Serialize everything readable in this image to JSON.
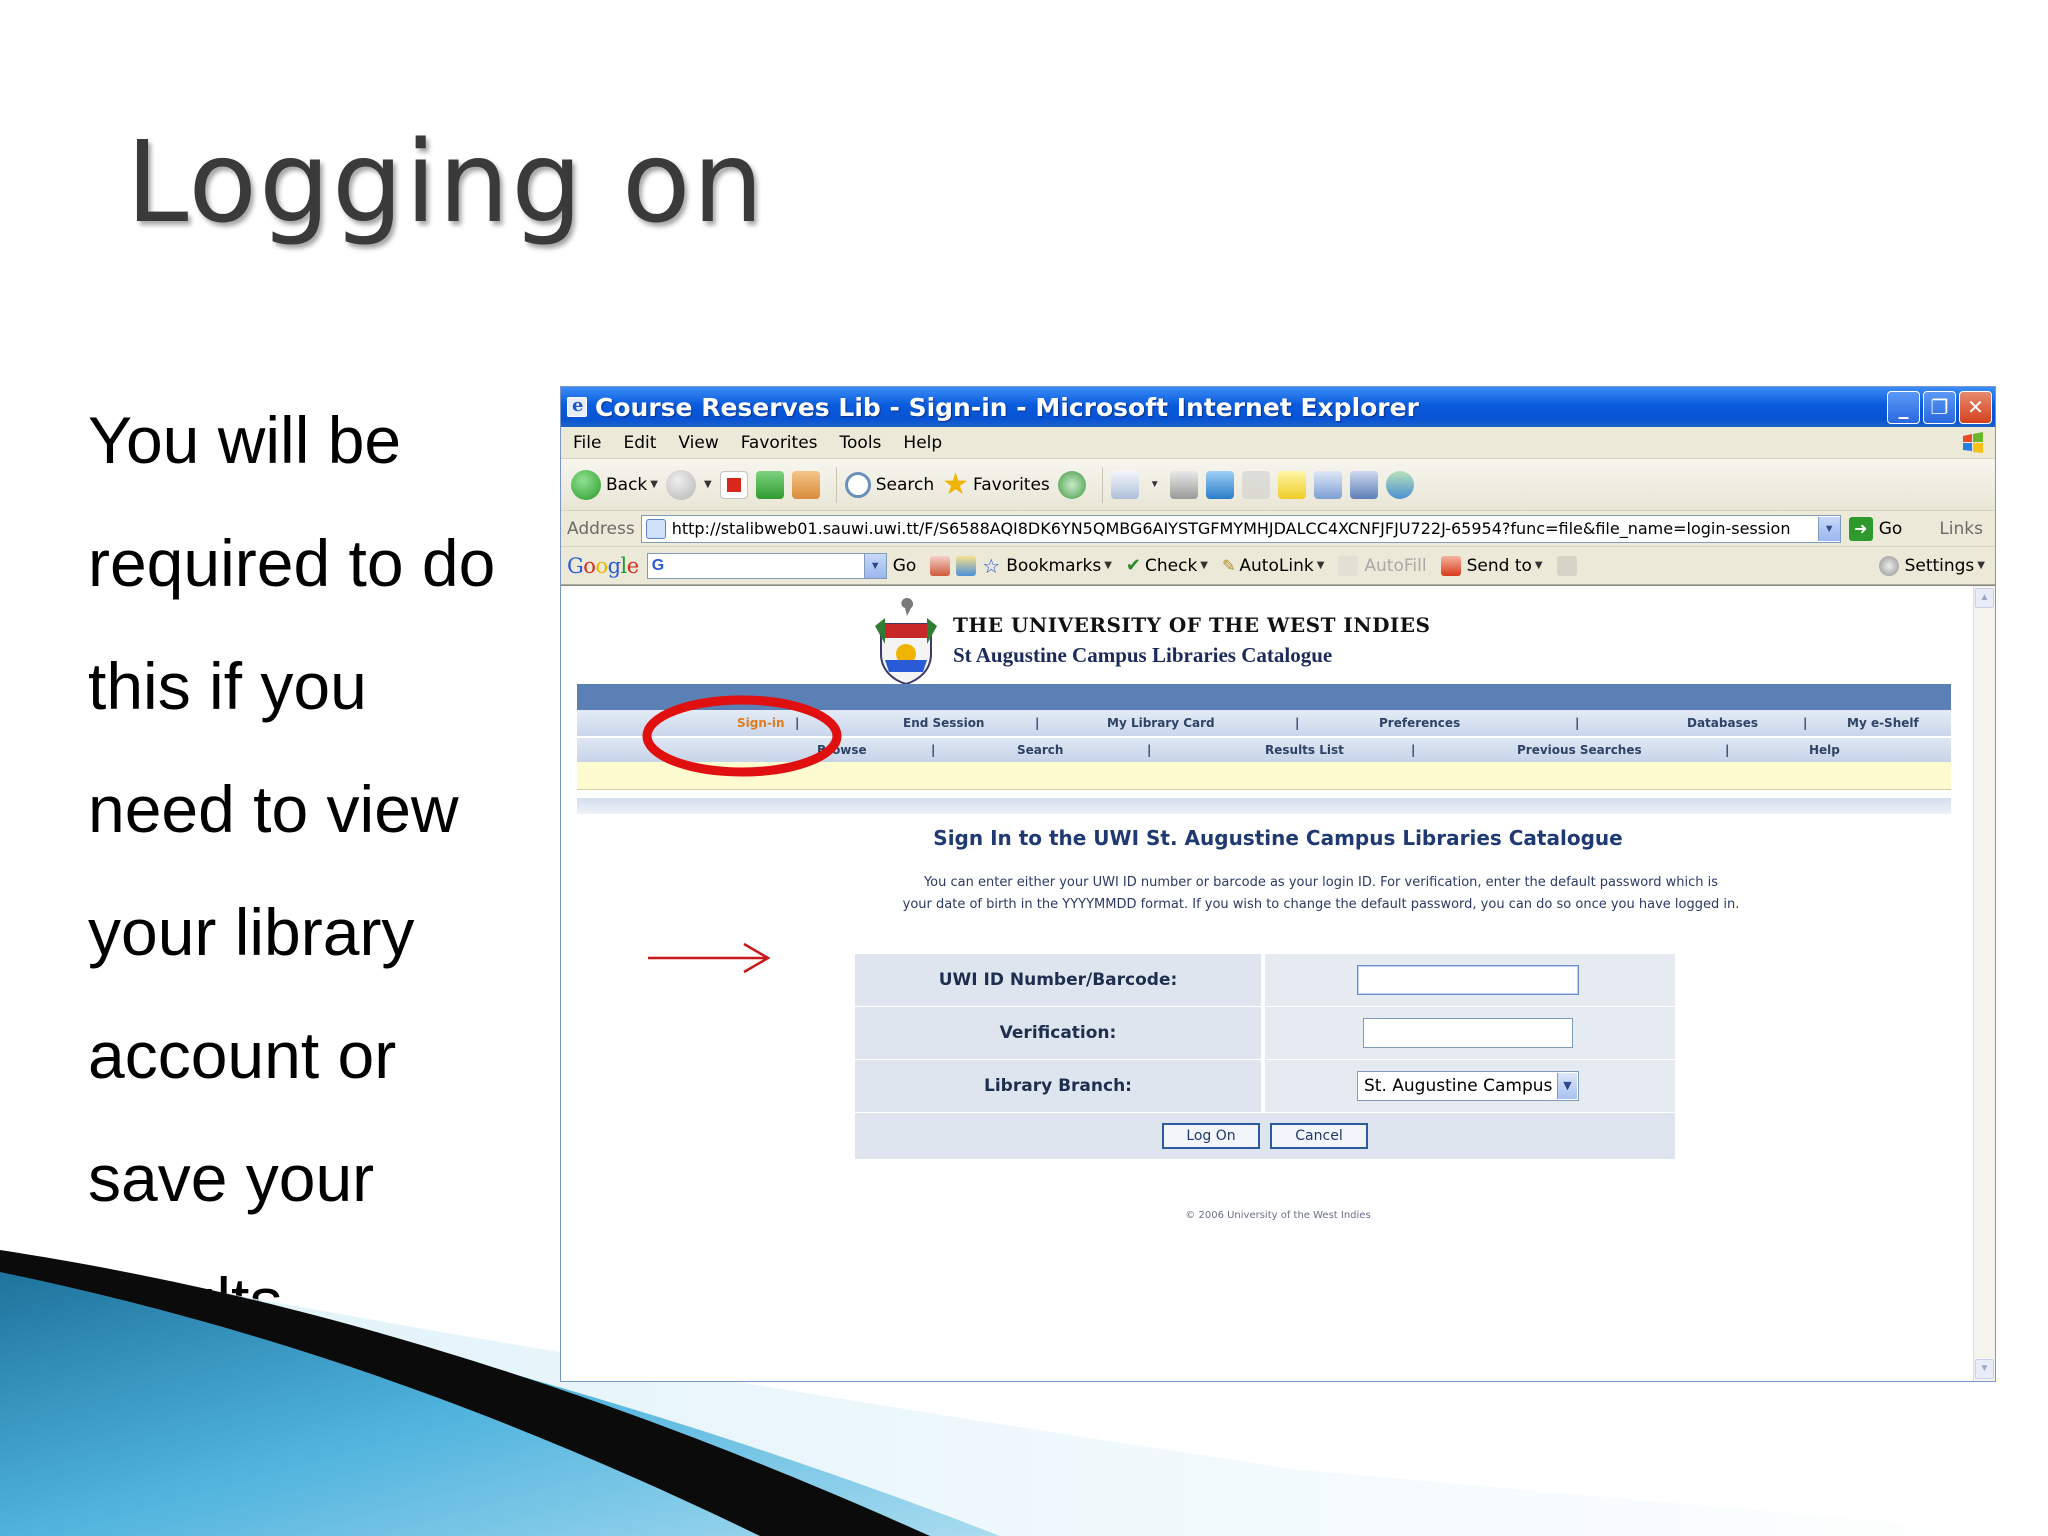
{
  "slide": {
    "title": "Logging on",
    "bullet_lines": [
      "You will be",
      "required to do",
      "this if you",
      "need to view",
      "your library",
      "account or",
      "save your",
      "results"
    ]
  },
  "window": {
    "title": "Course Reserves Lib - Sign-in - Microsoft Internet Explorer",
    "controls": {
      "minimize": "_",
      "restore": "❐",
      "close": "✕"
    }
  },
  "menu": [
    "File",
    "Edit",
    "View",
    "Favorites",
    "Tools",
    "Help"
  ],
  "toolbar": {
    "back": "Back",
    "search": "Search",
    "favorites": "Favorites"
  },
  "address": {
    "label": "Address",
    "url": "http://stalibweb01.sauwi.uwi.tt/F/S6588AQI8DK6YN5QMBG6AIYSTGFMYMHJDALCC4XCNFJFJU722J-65954?func=file&file_name=login-session",
    "go": "Go",
    "links": "Links"
  },
  "googlebar": {
    "logo": "Google",
    "g_glyph": "G",
    "go": "Go",
    "bookmarks": "Bookmarks",
    "check": "Check",
    "autolink": "AutoLink",
    "autofill": "AutoFill",
    "send_to": "Send to",
    "settings": "Settings"
  },
  "page": {
    "org_name": "THE UNIVERSITY OF THE WEST INDIES",
    "catalogue_name": "St Augustine Campus Libraries Catalogue",
    "nav_row1": [
      "Sign-in",
      "End Session",
      "My Library Card",
      "Preferences",
      "Databases",
      "My e-Shelf"
    ],
    "nav_row2": [
      "Browse",
      "Search",
      "Results List",
      "Previous Searches",
      "Help"
    ],
    "heading": "Sign In to the UWI St. Augustine Campus Libraries Catalogue",
    "help_line1": "You can enter either your UWI ID number or barcode as your login ID. For verification, enter the default password which is",
    "help_line2": "your date of birth in the YYYYMMDD format. If you wish to change the default password, you can do so once you have logged in.",
    "form": {
      "id_label": "UWI ID Number/Barcode:",
      "id_value": "",
      "verification_label": "Verification:",
      "verification_value": "",
      "branch_label": "Library Branch:",
      "branch_value": "St. Augustine Campus",
      "login_button": "Log On",
      "cancel_button": "Cancel"
    },
    "copyright": "© 2006 University of the West Indies"
  },
  "colors": {
    "titlebar": "#0a5bde",
    "callout_red": "#e01010",
    "nav_active": "#e07a1e",
    "swoosh_blue": "#3a9cc8"
  }
}
